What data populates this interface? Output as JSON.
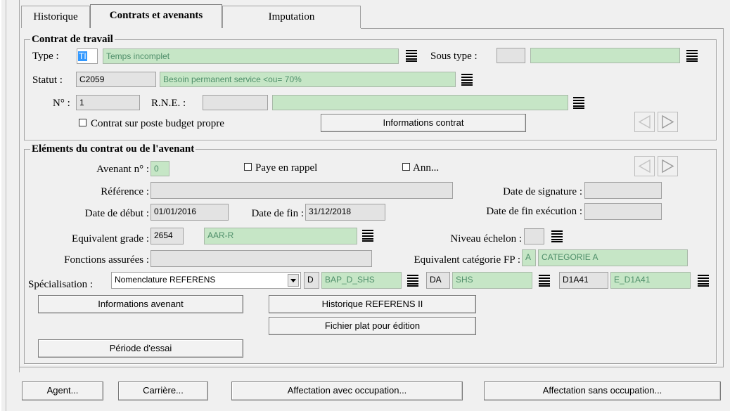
{
  "tabs": [
    {
      "label": "Historique"
    },
    {
      "label": "Contrats et avenants"
    },
    {
      "label": "Imputation"
    }
  ],
  "contrat": {
    "title": "Contrat de travail",
    "type_label": "Type :",
    "type_code": "TI",
    "type_value": "Temps incomplet",
    "sous_type_label": "Sous type :",
    "sous_type_code": "",
    "sous_type_value": "",
    "statut_label": "Statut :",
    "statut_code": "C2059",
    "statut_value": "Besoin permanent service <ou= 70%",
    "numero_label": "N° :",
    "numero_value": "1",
    "rne_label": "R.N.E. :",
    "rne_code": "",
    "rne_value": "",
    "budget_checkbox_label": "Contrat sur poste budget propre",
    "budget_checked": false,
    "info_button": "Informations contrat"
  },
  "avenant": {
    "title": "Eléments du contrat ou de l'avenant",
    "avenant_no_label": "Avenant n° :",
    "avenant_no_value": "0",
    "paye_rappel_label": "Paye en rappel",
    "paye_rappel_checked": false,
    "ann_label": "Ann...",
    "ann_checked": false,
    "reference_label": "Référence :",
    "reference_value": "",
    "date_signature_label": "Date de signature :",
    "date_signature_value": "",
    "date_debut_label": "Date de début :",
    "date_debut_value": "01/01/2016",
    "date_fin_label": "Date de fin :",
    "date_fin_value": "31/12/2018",
    "date_fin_exec_label": "Date de fin exécution :",
    "date_fin_exec_value": "",
    "equiv_grade_label": "Equivalent grade :",
    "equiv_grade_code": "2654",
    "equiv_grade_value": "AAR-R",
    "niveau_echelon_label": "Niveau échelon :",
    "niveau_echelon_value": "",
    "fonctions_label": "Fonctions assurées :",
    "fonctions_value": "",
    "equiv_cat_label": "Equivalent catégorie FP :",
    "equiv_cat_code": "A",
    "equiv_cat_value": "CATEGORIE A",
    "specialisation_label": "Spécialisation :",
    "specialisation_select": "Nomenclature REFERENS",
    "spec_bap_code": "D",
    "spec_bap_value": "BAP_D_SHS",
    "spec_da_code": "DA",
    "spec_da_value": "SHS",
    "spec_emploi_code": "D1A41",
    "spec_emploi_value": "E_D1A41",
    "btn_info_avenant": "Informations avenant",
    "btn_historique": "Historique REFERENS II",
    "btn_fichier": "Fichier plat pour édition",
    "btn_periode": "Période d'essai"
  },
  "footer": {
    "agent": "Agent...",
    "carriere": "Carrière...",
    "affect_avec": "Affectation avec occupation...",
    "affect_sans": "Affectation sans occupation..."
  },
  "colors": {
    "window_bg": "#f0f0f0",
    "field_green": "#c6e6c6",
    "field_grey": "#e3e3e3",
    "selection_blue": "#3399ff"
  }
}
